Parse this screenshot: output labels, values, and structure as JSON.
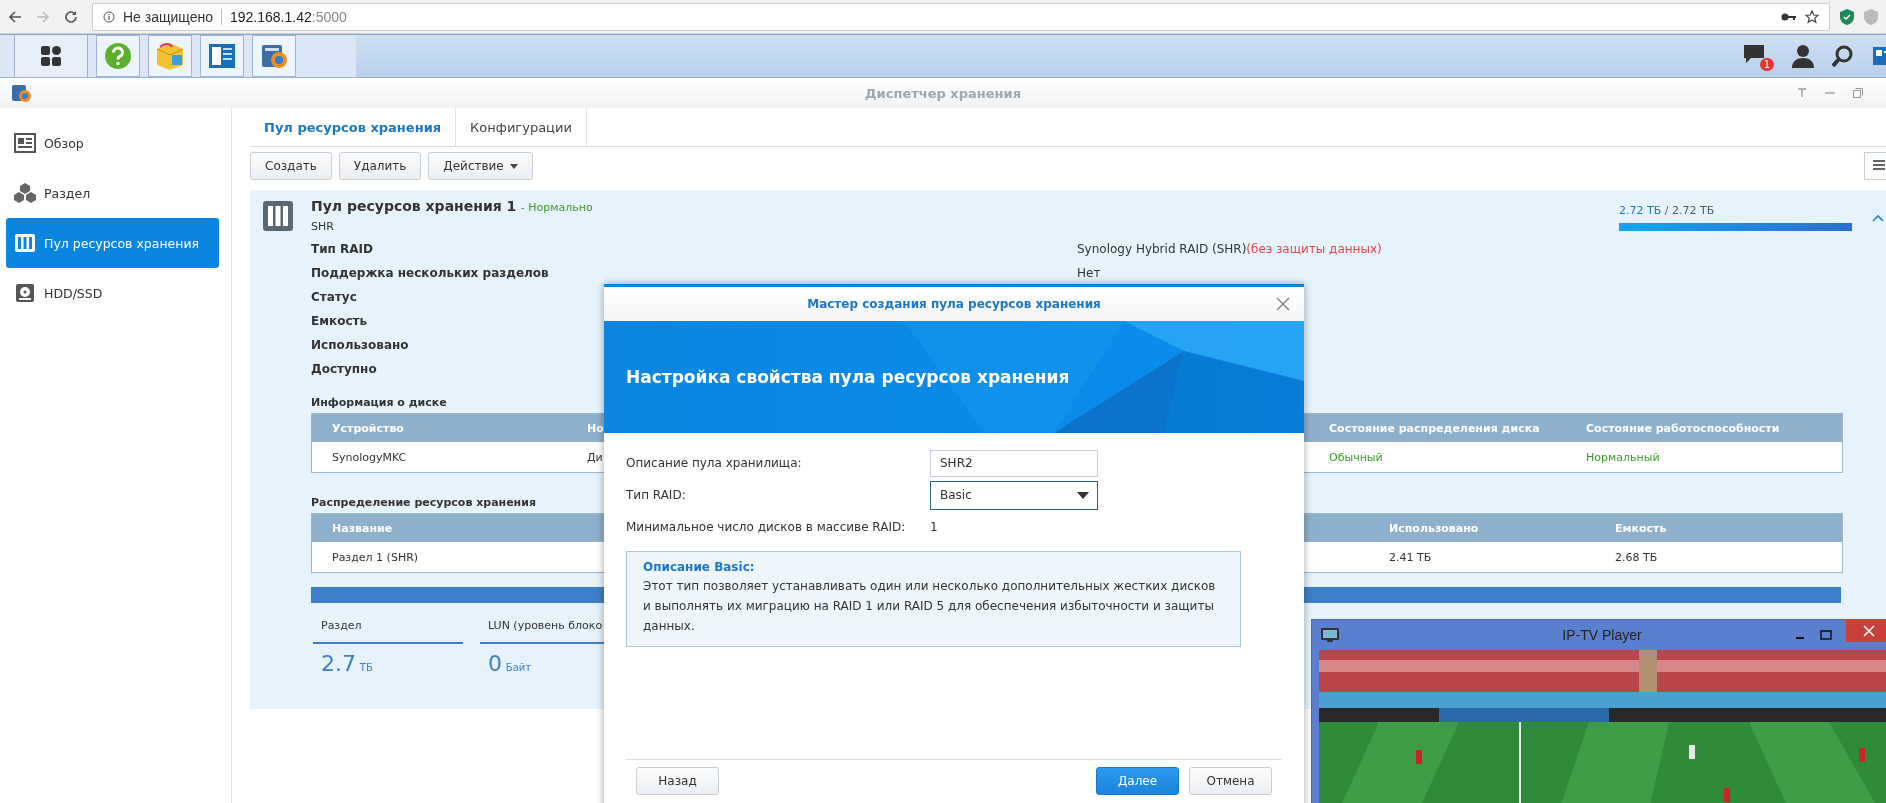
{
  "browser": {
    "security": "Не защищено",
    "url_host": "192.168.1.42",
    "url_port": ":5000"
  },
  "taskbar": {
    "apps": [
      {
        "kind": "help"
      },
      {
        "kind": "package"
      },
      {
        "kind": "panel"
      },
      {
        "kind": "storage"
      }
    ],
    "notification_count": "1"
  },
  "window": {
    "title": "Диспетчер хранения"
  },
  "sidebar": {
    "items": [
      {
        "label": "Обзор",
        "kind": "overview",
        "selected": false
      },
      {
        "label": "Раздел",
        "kind": "volume",
        "selected": false
      },
      {
        "label": "Пул ресурсов хранения",
        "kind": "pool",
        "selected": true
      },
      {
        "label": "HDD/SSD",
        "kind": "disk",
        "selected": false
      }
    ]
  },
  "tabs": [
    {
      "label": "Пул ресурсов хранения",
      "selected": true
    },
    {
      "label": "Конфигурации",
      "selected": false
    }
  ],
  "toolbar": {
    "buttons": [
      {
        "label": "Создать",
        "dropdown": false
      },
      {
        "label": "Удалить",
        "dropdown": false
      },
      {
        "label": "Действие",
        "dropdown": true
      }
    ]
  },
  "pool": {
    "title": "Пул ресурсов хранения 1",
    "status": "- Нормально",
    "subtitle": "SHR",
    "used": "2.72 ТБ",
    "total": "/ 2.72 ТБ",
    "level": 1,
    "expanded": true,
    "details": [
      {
        "label": "Тип RAID",
        "value": "Synology Hybrid RAID (SHR)",
        "note": "(без защиты данных)"
      },
      {
        "label": "Поддержка нескольких разделов",
        "value": "Нет"
      },
      {
        "label": "Статус"
      },
      {
        "label": "Емкость"
      },
      {
        "label": "Использовано"
      },
      {
        "label": "Доступно"
      }
    ],
    "disk_info": {
      "title": "Информация о диске",
      "columns": [
        "Устройство",
        "Но",
        "Состояние распределения диска",
        "Состояние работоспособности"
      ],
      "rows": [
        [
          "SynologyMKC",
          "Ди",
          "Обычный",
          "Нормальный"
        ]
      ]
    },
    "allocation": {
      "title": "Распределение ресурсов хранения",
      "columns": [
        "Название",
        "Использовано",
        "Емкость"
      ],
      "rows": [
        [
          "Раздел 1 (SHR)",
          "2.41 ТБ",
          "2.68 ТБ"
        ]
      ]
    },
    "stats": [
      {
        "label": "Раздел",
        "value": "2.7",
        "unit": "ТБ"
      },
      {
        "label": "LUN (уровень блоко",
        "value": "0",
        "unit": "Байт"
      }
    ]
  },
  "dialog": {
    "title": "Мастер создания пула ресурсов хранения",
    "heading": "Настройка свойства пула ресурсов хранения",
    "fields": [
      {
        "kind": "text",
        "label": "Описание пула хранилища:",
        "value": "SHR2"
      },
      {
        "kind": "select",
        "label": "Тип RAID:",
        "value": "Basic"
      },
      {
        "kind": "static",
        "label": "Минимальное число дисков в массиве RAID:",
        "value": "1"
      }
    ],
    "info": {
      "title": "Описание Basic:",
      "text": "Этот тип позволяет устанавливать один или несколько дополнительных жестких дисков и выполнять их миграцию на RAID 1 или RAID 5 для обеспечения избыточности и защиты данных."
    },
    "buttons": [
      {
        "label": "Назад",
        "primary": false
      },
      {
        "label": "Далее",
        "primary": true
      },
      {
        "label": "Отмена",
        "primary": false
      }
    ]
  },
  "player": {
    "title": "IP-TV Player"
  }
}
